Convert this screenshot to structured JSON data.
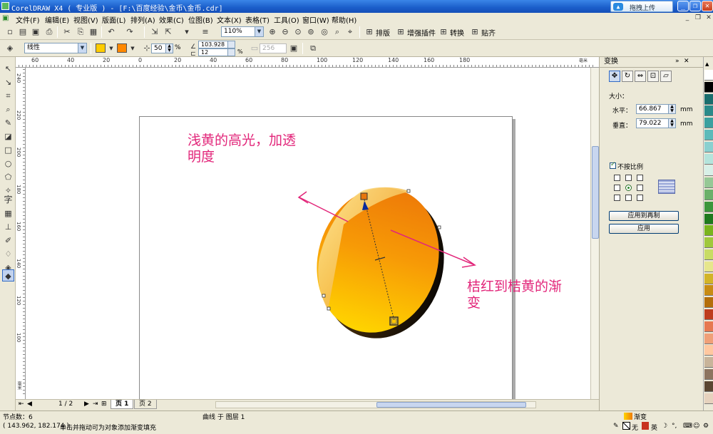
{
  "window": {
    "title": "CorelDRAW X4 ( 专业版 ) - [F:\\百度经验\\金币\\金币.cdr]",
    "upload_label": "拖拽上传"
  },
  "menu": [
    "文件(F)",
    "编辑(E)",
    "视图(V)",
    "版面(L)",
    "排列(A)",
    "效果(C)",
    "位图(B)",
    "文本(X)",
    "表格(T)",
    "工具(O)",
    "窗口(W)",
    "帮助(H)"
  ],
  "toolbar": {
    "zoom": "110%",
    "plugins": [
      "排版",
      "增强插件",
      "转换",
      "贴齐"
    ]
  },
  "property_bar": {
    "fill_type": "线性",
    "color_from": "#ffcc00",
    "color_to": "#ff8800",
    "midpoint": "50",
    "percent": "%",
    "angle": "103.928",
    "edge_pad": "12",
    "steps": "256"
  },
  "ruler": {
    "h_labels": [
      "60",
      "40",
      "20",
      "0",
      "20",
      "40",
      "60",
      "80",
      "100",
      "120",
      "140",
      "160",
      "180"
    ],
    "h_unit": "毫米",
    "v_labels": [
      "240",
      "220",
      "200",
      "180",
      "160",
      "140",
      "120",
      "100"
    ],
    "v_unit": "毫米"
  },
  "pages": {
    "counter": "1 / 2",
    "tabs": [
      "页 1",
      "页 2"
    ]
  },
  "docker": {
    "title": "变换",
    "size_label": "大小：",
    "h_label": "水平：",
    "h_value": "66.867",
    "v_label": "垂直：",
    "v_value": "79.022",
    "unit": "mm",
    "proportional_label": "不按比例",
    "apply_duplicate": "应用到再制",
    "apply": "应用"
  },
  "annotations": {
    "note1": "浅黄的高光，加透明度",
    "note2": "桔红到桔黄的渐变"
  },
  "status": {
    "nodes": "节点数：6",
    "object": "曲线 于 图层 1",
    "coords": "( 143.962, 182.174 )",
    "hint": "单击并拖动可为对象添加渐变填充",
    "fill_label": "渐变",
    "outline_label": "无",
    "ime_label": "英"
  },
  "colors": {
    "palette": [
      "#ffffff",
      "#000000",
      "#1a6e6e",
      "#2a8a8a",
      "#3aa0a0",
      "#5cbaba",
      "#8ad0d0",
      "#b4e4dc",
      "#d8f0e8",
      "#96c896",
      "#6ab06a",
      "#3c963c",
      "#1e7a1e",
      "#7ab41e",
      "#a0c83c",
      "#c8dc64",
      "#e6e68c",
      "#d2b428",
      "#c88c14",
      "#b46e0a",
      "#be3c1e",
      "#e67850",
      "#f0a078",
      "#ffc8a0",
      "#c8b49a",
      "#8c7460",
      "#5a4632",
      "#e6d2be"
    ]
  }
}
